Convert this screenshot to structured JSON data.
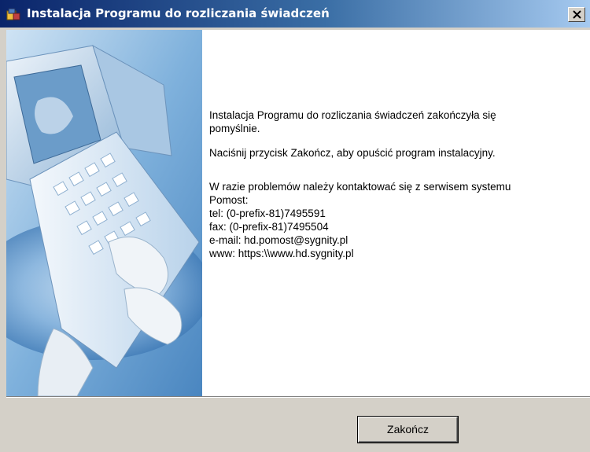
{
  "window": {
    "title": "Instalacja Programu do rozliczania świadczeń",
    "app_icon": "installer-icon",
    "close_icon": "close-icon"
  },
  "side_image": {
    "description_icon": "computer-keyboard-illustration"
  },
  "message": {
    "line1": "Instalacja Programu do rozliczania świadczeń zakończyła się",
    "line2": "pomyślnie.",
    "line3": "Naciśnij przycisk Zakończ, aby opuścić program instalacyjny.",
    "support_line1": "W razie problemów należy kontaktować się z serwisem systemu",
    "support_line2": "Pomost:",
    "tel": "tel:  (0-prefix-81)7495591",
    "fax": "fax: (0-prefix-81)7495504",
    "email": "e-mail: hd.pomost@sygnity.pl",
    "www": "www: https:\\\\www.hd.sygnity.pl"
  },
  "buttons": {
    "finish_label": "Zakończ"
  },
  "colors": {
    "title_start": "#0a246a",
    "title_end": "#a6caf0",
    "face": "#d4d0c8"
  }
}
